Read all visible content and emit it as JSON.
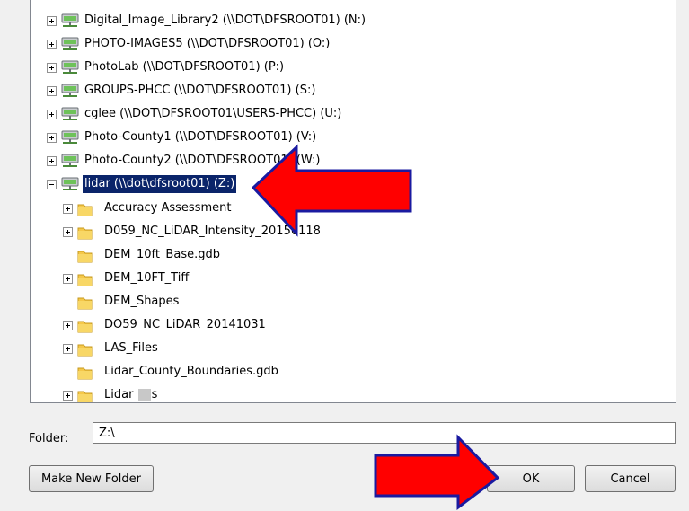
{
  "tree": {
    "drives": [
      {
        "label": "Digital_Image_Library2 (\\\\DOT\\DFSROOT01) (N:)"
      },
      {
        "label": "PHOTO-IMAGES5 (\\\\DOT\\DFSROOT01) (O:)"
      },
      {
        "label": "PhotoLab (\\\\DOT\\DFSROOT01) (P:)"
      },
      {
        "label": "GROUPS-PHCC (\\\\DOT\\DFSROOT01) (S:)"
      },
      {
        "label": "cglee (\\\\DOT\\DFSROOT01\\USERS-PHCC) (U:)"
      },
      {
        "label": "Photo-County1 (\\\\DOT\\DFSROOT01) (V:)"
      },
      {
        "label": "Photo-County2 (\\\\DOT\\DFSROOT01) (W:)"
      },
      {
        "label": "lidar (\\\\dot\\dfsroot01) (Z:)",
        "selected": true,
        "expanded": true
      }
    ],
    "folders": [
      {
        "label": "Accuracy Assessment",
        "expandable": true
      },
      {
        "label": "D059_NC_LiDAR_Intensity_20150118",
        "expandable": true
      },
      {
        "label": "DEM_10ft_Base.gdb",
        "expandable": false
      },
      {
        "label": "DEM_10FT_Tiff",
        "expandable": true
      },
      {
        "label": "DEM_Shapes",
        "expandable": false
      },
      {
        "label": "DO59_NC_LiDAR_20141031",
        "expandable": true
      },
      {
        "label": "LAS_Files",
        "expandable": true
      },
      {
        "label": "Lidar_County_Boundaries.gdb",
        "expandable": false
      },
      {
        "label_start": "Lidar",
        "label_end": "s",
        "expandable": true
      }
    ]
  },
  "folder_field": {
    "label": "Folder:",
    "value": "Z:\\"
  },
  "buttons": {
    "make_new_folder": "Make New Folder",
    "ok": "OK",
    "cancel": "Cancel"
  },
  "annotations": {
    "arrow_color": "#ff0000",
    "arrow_outline": "#1a1aa0"
  },
  "colors": {
    "selection": "#0a246a",
    "folder": "#f5c84a"
  }
}
